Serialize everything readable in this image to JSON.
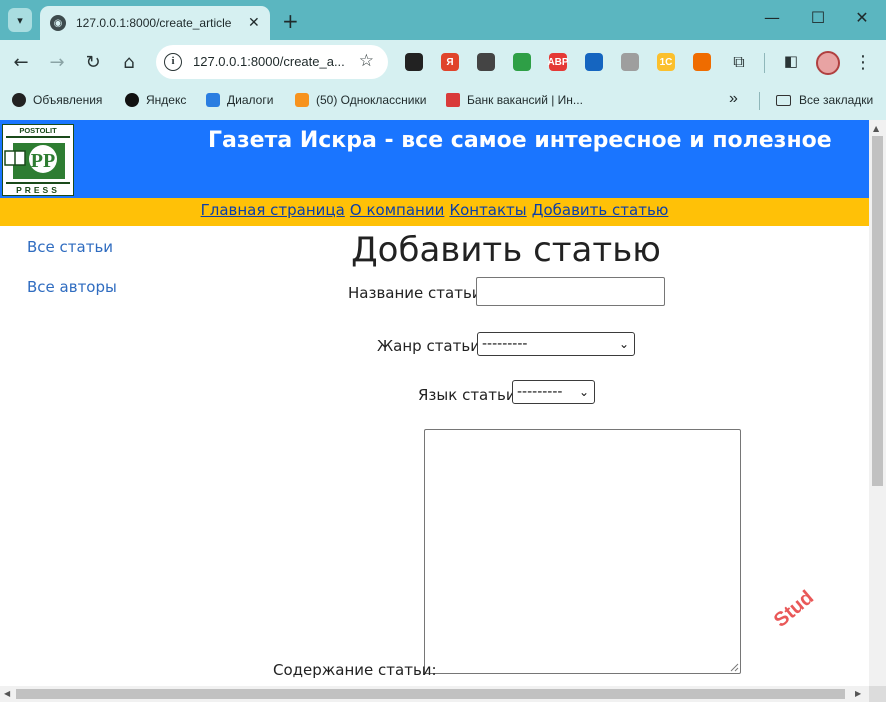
{
  "browser": {
    "tab": {
      "title": "127.0.0.1:8000/create_article",
      "icon": "globe-icon"
    },
    "address": {
      "url": "127.0.0.1:8000/create_a..."
    },
    "bookmarks": [
      {
        "label": "Объявления",
        "color": "#222222"
      },
      {
        "label": "Яндекс",
        "color": "#111111"
      },
      {
        "label": "Диалоги",
        "color": "#2a7de1"
      },
      {
        "label": "(50) Одноклассники",
        "color": "#f7931e"
      },
      {
        "label": "Банк вакансий | Ин...",
        "color": "#d93a3a"
      }
    ],
    "overflow": "»",
    "all_bookmarks": "Все закладки",
    "extensions": [
      {
        "name": "ext-cat-icon",
        "text": "",
        "color": "#222222"
      },
      {
        "name": "ext-yandex-icon",
        "text": "Я",
        "color": "#e0442b"
      },
      {
        "name": "ext-shield-icon",
        "text": "",
        "color": "#444444"
      },
      {
        "name": "ext-home-icon",
        "text": "",
        "color": "#2e9f46"
      },
      {
        "name": "ext-abp-icon",
        "text": "ABP",
        "color": "#e53935"
      },
      {
        "name": "ext-globe-icon",
        "text": "",
        "color": "#1565c0"
      },
      {
        "name": "ext-gray-shield-icon",
        "text": "",
        "color": "#9e9e9e"
      },
      {
        "name": "ext-1c-icon",
        "text": "1C",
        "color": "#fbc02d"
      },
      {
        "name": "ext-firefox-icon",
        "text": "",
        "color": "#ef6c00"
      }
    ]
  },
  "site": {
    "logo": {
      "top_text": "POSTOLIT",
      "bottom_text": "PRESS"
    },
    "title": "Газета Искра - все самое интересное и полезное",
    "menu": [
      "Главная страница",
      "О компании",
      "Контакты",
      "Добавить статью"
    ],
    "sidebar": [
      "Все статьи",
      "Все авторы"
    ]
  },
  "form": {
    "heading": "Добавить статью",
    "title_label": "Название статьи:",
    "title_value": "",
    "genre_label": "Жанр статьи:",
    "genre_selected": "---------",
    "language_label": "Язык статьи:",
    "language_selected": "---------",
    "content_label": "Содержание статьи:",
    "content_value": ""
  },
  "watermark": "Stud"
}
